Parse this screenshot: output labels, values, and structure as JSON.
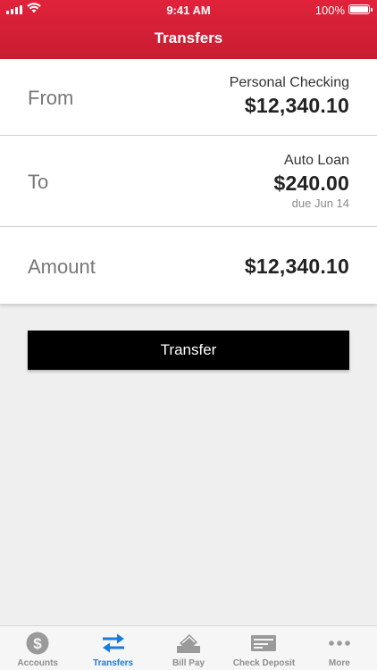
{
  "status_bar": {
    "time": "9:41 AM",
    "battery": "100%"
  },
  "nav": {
    "title": "Transfers"
  },
  "from": {
    "label": "From",
    "account": "Personal Checking",
    "amount": "$12,340.10"
  },
  "to": {
    "label": "To",
    "account": "Auto Loan",
    "amount": "$240.00",
    "due": "due Jun 14"
  },
  "amount": {
    "label": "Amount",
    "value": "$12,340.10"
  },
  "actions": {
    "transfer_label": "Transfer"
  },
  "tabs": [
    {
      "label": "Accounts",
      "icon": "dollar-circle-icon"
    },
    {
      "label": "Transfers",
      "icon": "transfer-arrows-icon",
      "active": true
    },
    {
      "label": "Bill Pay",
      "icon": "bill-pay-icon"
    },
    {
      "label": "Check Deposit",
      "icon": "check-deposit-icon"
    },
    {
      "label": "More",
      "icon": "more-dots-icon"
    }
  ],
  "colors": {
    "header_red": "#d41f35",
    "accent_blue": "#1a7be0",
    "button": "#000000"
  }
}
